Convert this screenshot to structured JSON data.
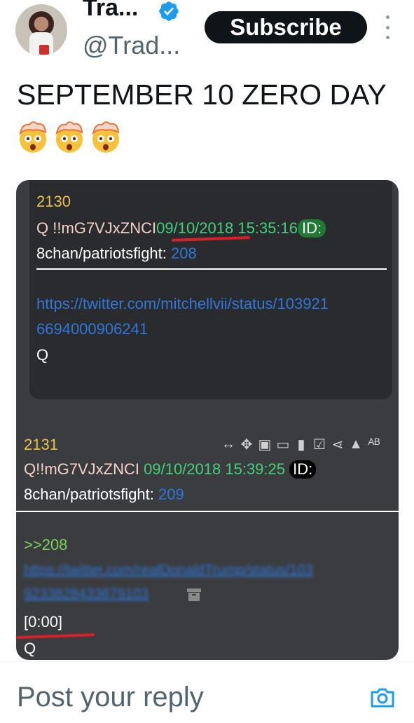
{
  "author": {
    "name": "Tra...",
    "handle": "@Trad...",
    "verified_icon": "verified-badge-icon",
    "verified_color": "#1d9bf0"
  },
  "subscribe_label": "Subscribe",
  "tweet": {
    "text": "SEPTEMBER 10 ZERO DAY",
    "emoji": [
      "🤯",
      "🤯",
      "🤯"
    ]
  },
  "post1": {
    "number": "2130",
    "trip": "Q !!mG7VJxZNCI",
    "date": "09/10/2018 15:35:16",
    "id_label": "ID:",
    "board": "8chan/patriotsfight:",
    "board_num": "208",
    "link_line1": "https://twitter.com/mitchellvii/status/103921",
    "link_line2": "6694000906241",
    "signature": "Q"
  },
  "post2": {
    "number": "2131",
    "trip": "Q!!mG7VJxZNCI",
    "date": "09/10/2018 15:39:25",
    "id_label": "ID:",
    "board": "8chan/patriotsfight:",
    "board_num": "209",
    "reply_ref": ">>208",
    "blurred_line1": "https://twitter.com/realDonaldTrump/status/103",
    "blurred_line2": "9233828433679103",
    "timestamp": "[0:00]",
    "signature": "Q"
  },
  "colors": {
    "media_bg": "#3b3c40",
    "post_bg": "#2a2b2e",
    "accent_red": "#d9202a",
    "link": "#2f77d8"
  },
  "reply": {
    "placeholder": "Post your reply"
  }
}
